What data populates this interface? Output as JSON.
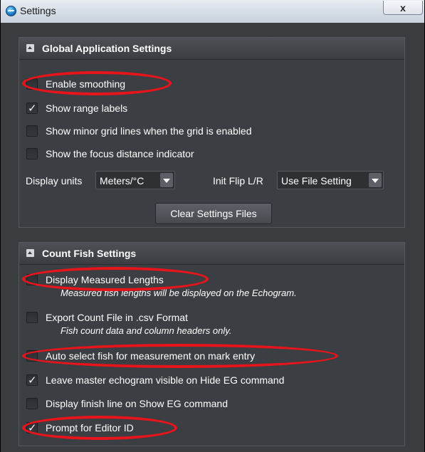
{
  "window": {
    "title": "Settings",
    "close_label": "x"
  },
  "global": {
    "header": "Global Application Settings",
    "options": [
      {
        "label": "Enable smoothing",
        "checked": false
      },
      {
        "label": "Show range labels",
        "checked": true
      },
      {
        "label": "Show minor grid lines when the grid is enabled",
        "checked": false
      },
      {
        "label": "Show the focus distance indicator",
        "checked": false
      }
    ],
    "display_units_label": "Display units",
    "display_units_value": "Meters/°C",
    "init_flip_label": "Init Flip L/R",
    "init_flip_value": "Use File Setting",
    "clear_button": "Clear Settings Files"
  },
  "count_fish": {
    "header": "Count Fish Settings",
    "options": [
      {
        "label": "Display Measured Lengths",
        "checked": false,
        "sub": "Measured fish lengths will be displayed on the Echogram."
      },
      {
        "label": "Export Count File in .csv Format",
        "checked": false,
        "sub": "Fish count data and column headers only."
      },
      {
        "label": "Auto select fish for measurement on mark entry",
        "checked": false
      },
      {
        "label": "Leave master echogram visible on Hide EG command",
        "checked": true
      },
      {
        "label": "Display finish line on Show EG command",
        "checked": false
      },
      {
        "label": "Prompt for Editor ID",
        "checked": true
      }
    ]
  },
  "annotation_color": "#e8141b"
}
